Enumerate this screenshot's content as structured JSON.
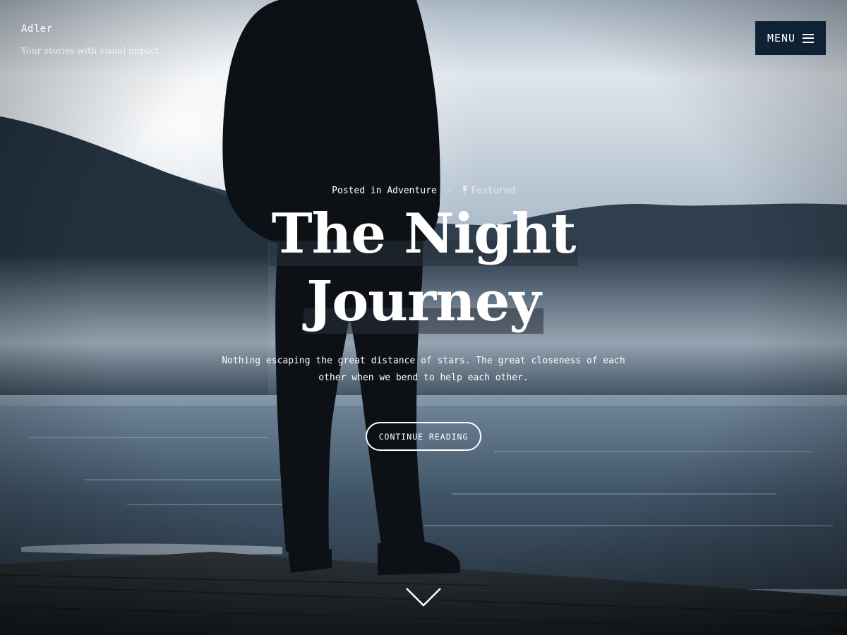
{
  "header": {
    "site_title": "Adler",
    "tagline": "Your stories with visual impact",
    "menu_label": "MENU",
    "menu_icon": "hamburger-icon"
  },
  "post": {
    "posted_in_prefix": "Posted in",
    "category": "Adventure",
    "separator": "-",
    "featured_icon": "pin-icon",
    "featured_label": "Featured",
    "title_line1": "The Night",
    "title_line2": "Journey",
    "excerpt": "Nothing escaping the great distance of stars. The great closeness of each other when we bend to help each other.",
    "cta_label": "CONTINUE READING",
    "scroll_icon": "chevron-down-icon"
  },
  "colors": {
    "menu_background": "#0e2135",
    "text": "#ffffff",
    "title_highlight": "#28303a"
  }
}
